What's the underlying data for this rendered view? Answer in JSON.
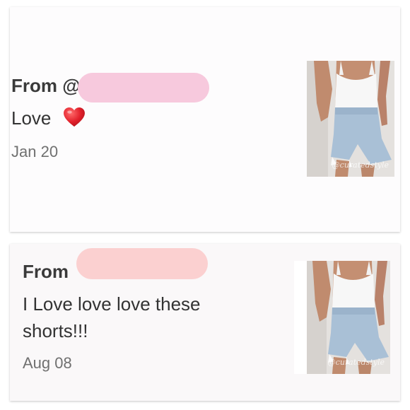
{
  "comments": [
    {
      "from_label": "From @",
      "text": "Love",
      "emoji_icon": "red-heart-icon",
      "date": "Jan 20",
      "redaction_color": "#f7c9dd",
      "watermark": "@curatedstyle"
    },
    {
      "from_label": "From",
      "text_line1": "I Love love love these",
      "text_line2": "shorts!!!",
      "date": "Aug 08",
      "redaction_color": "#fbd0d0",
      "watermark": "@curatedstyle"
    }
  ],
  "colors": {
    "text": "#333333",
    "date": "#707070",
    "heart": "#e2202b",
    "card_background": "#fdfcfd"
  }
}
